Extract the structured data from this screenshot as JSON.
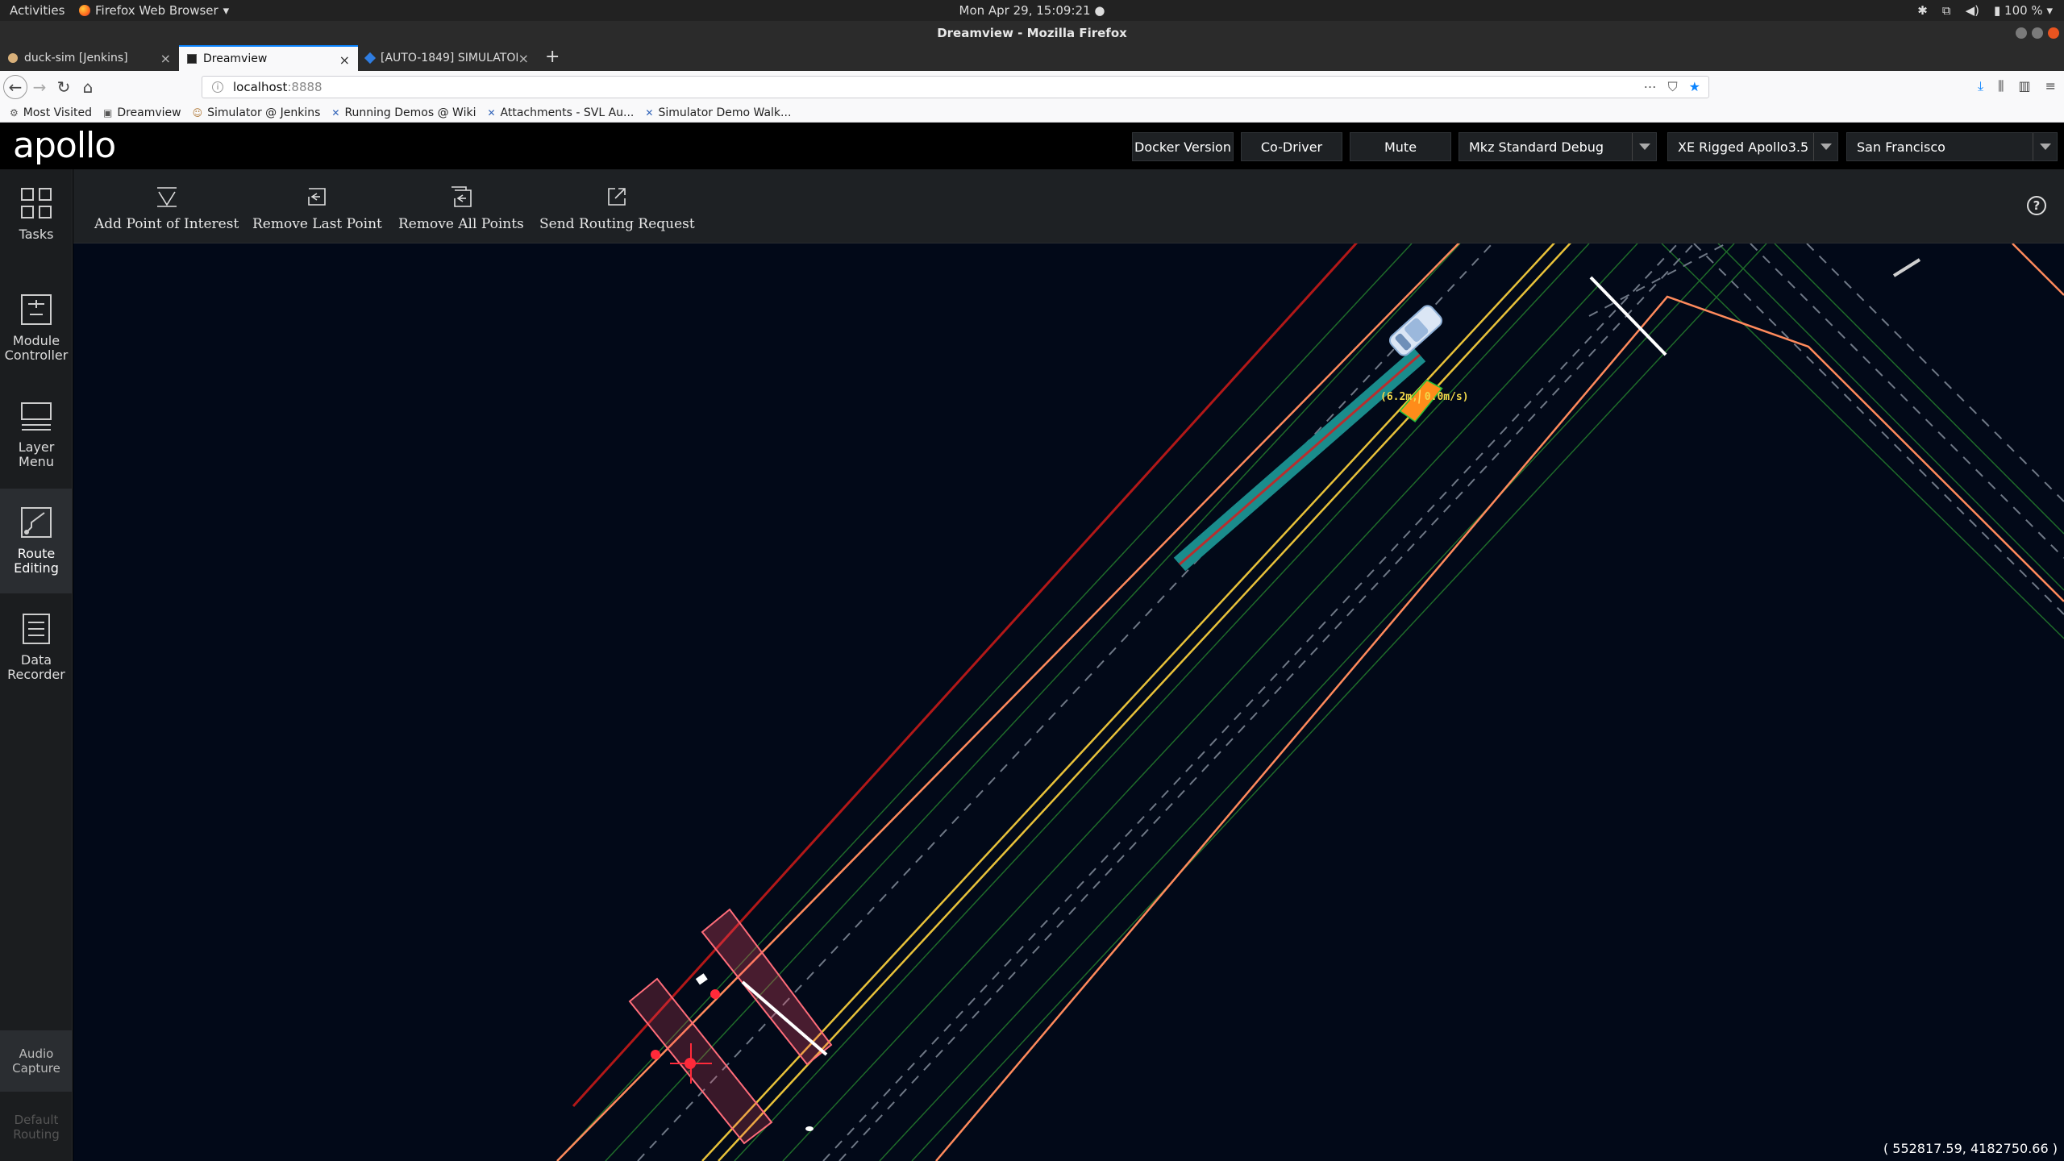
{
  "system": {
    "activities": "Activities",
    "app_menu": "Firefox Web Browser",
    "clock": "Mon Apr 29, 15:09:21",
    "battery": "100 %"
  },
  "window": {
    "title": "Dreamview - Mozilla Firefox"
  },
  "tabs": [
    {
      "title": "duck-sim [Jenkins]"
    },
    {
      "title": "Dreamview"
    },
    {
      "title": "[AUTO-1849] SIMULATOR"
    }
  ],
  "address": {
    "host": "localhost",
    "port": ":8888"
  },
  "bookmarks": [
    "Most Visited",
    "Dreamview",
    "Simulator @ Jenkins",
    "Running Demos @ Wiki",
    "Attachments - SVL Au...",
    "Simulator Demo Walk..."
  ],
  "header": {
    "logo": "apollo",
    "docker_version": "Docker Version",
    "co_driver": "Co-Driver",
    "mute": "Mute",
    "mode_select": "Mkz Standard Debug",
    "vehicle_select": "XE Rigged Apollo3.5",
    "map_select": "San Francisco"
  },
  "side_menu": {
    "tasks": "Tasks",
    "module_controller": [
      "Module",
      "Controller"
    ],
    "layer_menu": [
      "Layer",
      "Menu"
    ],
    "route_editing": [
      "Route",
      "Editing"
    ],
    "data_recorder": [
      "Data",
      "Recorder"
    ],
    "audio_capture": [
      "Audio",
      "Capture"
    ],
    "default_routing": [
      "Default",
      "Routing"
    ]
  },
  "route_tools": {
    "add_poi": "Add Point of Interest",
    "remove_last": "Remove Last Point",
    "remove_all": "Remove All Points",
    "send_routing": "Send Routing Request"
  },
  "scene": {
    "obstacle_label": "(6.2m, 0.0m/s)",
    "coordinates": "( 552817.59, 4182750.66 )"
  },
  "colors": {
    "road_boundary": "#ff8a5c",
    "planning_path": "#1a8c8c",
    "reference_line": "#d42020",
    "lane_yellow": "#e8c23a",
    "obstacle": "#ff8c1a",
    "stop_zone": "#ff6d7a",
    "scene_bg": "#020918"
  }
}
